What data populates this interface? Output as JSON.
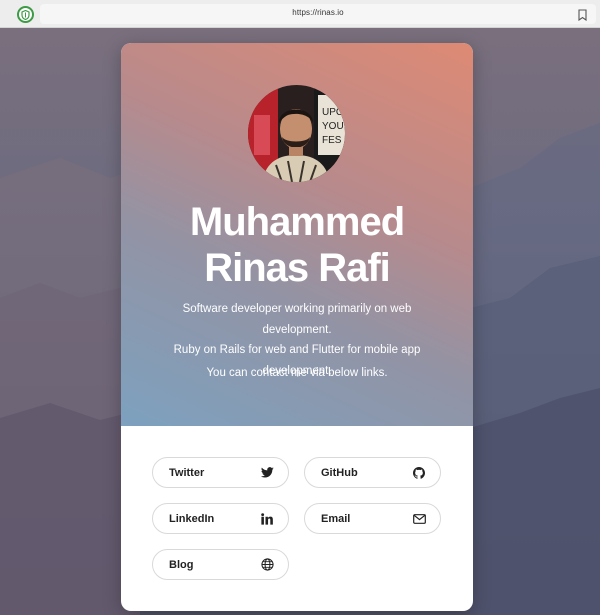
{
  "browser": {
    "url": "https://rinas.io",
    "shield_icon": "shield-icon",
    "bookmark_icon": "bookmark-icon"
  },
  "profile": {
    "name_line1": "Muhammed",
    "name_line2": "Rinas Rafi",
    "bio_line1": "Software developer working primarily on web development.",
    "bio_line2": "Ruby on Rails for web and Flutter for mobile app",
    "bio_line3": "development.",
    "contact": "You can contact me via below links."
  },
  "links": [
    {
      "label": "Twitter",
      "icon": "twitter-icon"
    },
    {
      "label": "GitHub",
      "icon": "github-icon"
    },
    {
      "label": "LinkedIn",
      "icon": "linkedin-icon"
    },
    {
      "label": "Email",
      "icon": "email-icon"
    },
    {
      "label": "Blog",
      "icon": "globe-icon"
    }
  ],
  "colors": {
    "hero_top": "#de8a74",
    "hero_bottom": "#7da1bf",
    "shield_green": "#3d9a45"
  }
}
